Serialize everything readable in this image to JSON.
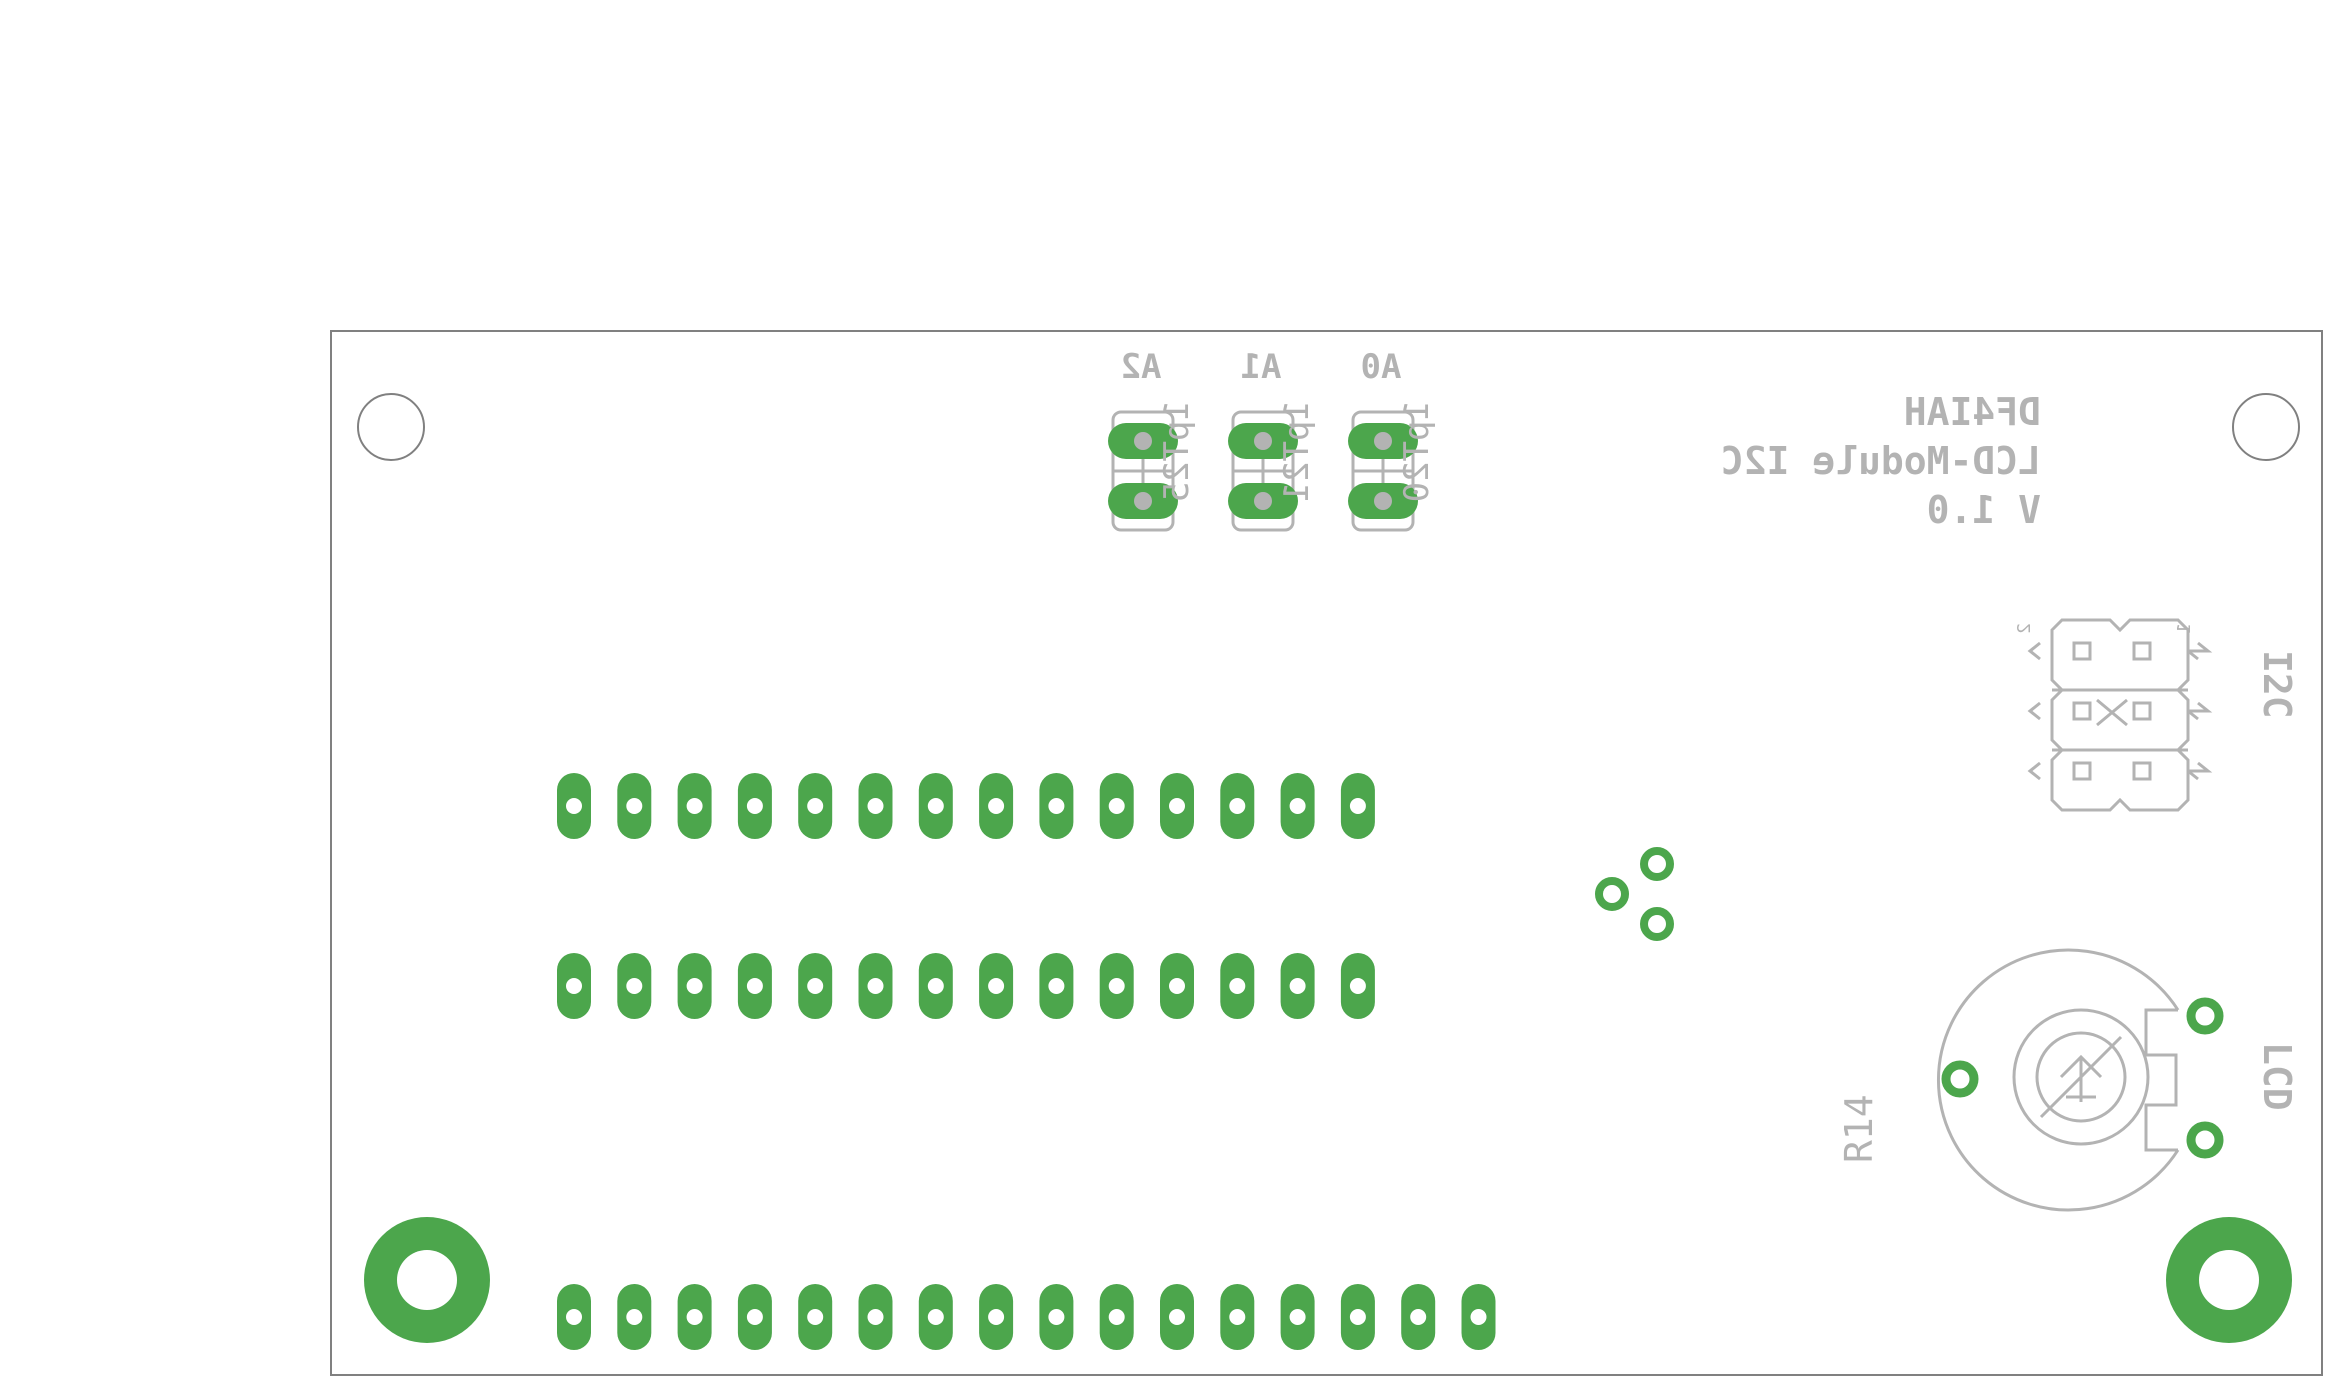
{
  "board": {
    "title_lines": [
      "DF4IAH",
      "LCD-Module   I2C",
      "V 1.0"
    ],
    "jumpers": [
      {
        "top_label": "A2",
        "side_label": "1pT25"
      },
      {
        "top_label": "A1",
        "side_label": "1pT21"
      },
      {
        "top_label": "A0",
        "side_label": "1pT20"
      }
    ],
    "i2c_label": "I2C",
    "i2c_pin_numbers": [
      "2",
      "1"
    ],
    "lcd_label": "LCD",
    "pot_label": "R14",
    "row1_pad_count": 14,
    "row2_pad_count": 14,
    "row3_pad_count": 16
  },
  "colors": {
    "copper": "#4ca64c",
    "silkscreen": "#b3b3b3",
    "outline": "#808080",
    "background": "#ffffff"
  }
}
